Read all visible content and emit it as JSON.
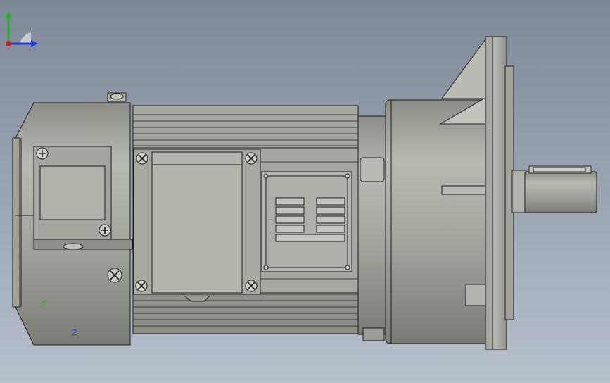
{
  "viewport": {
    "background_top": "#7e8898",
    "background_bottom": "#b7c0cb"
  },
  "model": {
    "body_color": "#a9aaa2",
    "body_light": "#c6c7bf",
    "body_dark": "#7d7e77",
    "edge_color": "#1d1d1b"
  },
  "triad": {
    "y_label": "Y",
    "z_label": "Z",
    "y_color": "#1db41d",
    "z_color": "#1e3fd6",
    "x_color": "#d41c1c"
  }
}
